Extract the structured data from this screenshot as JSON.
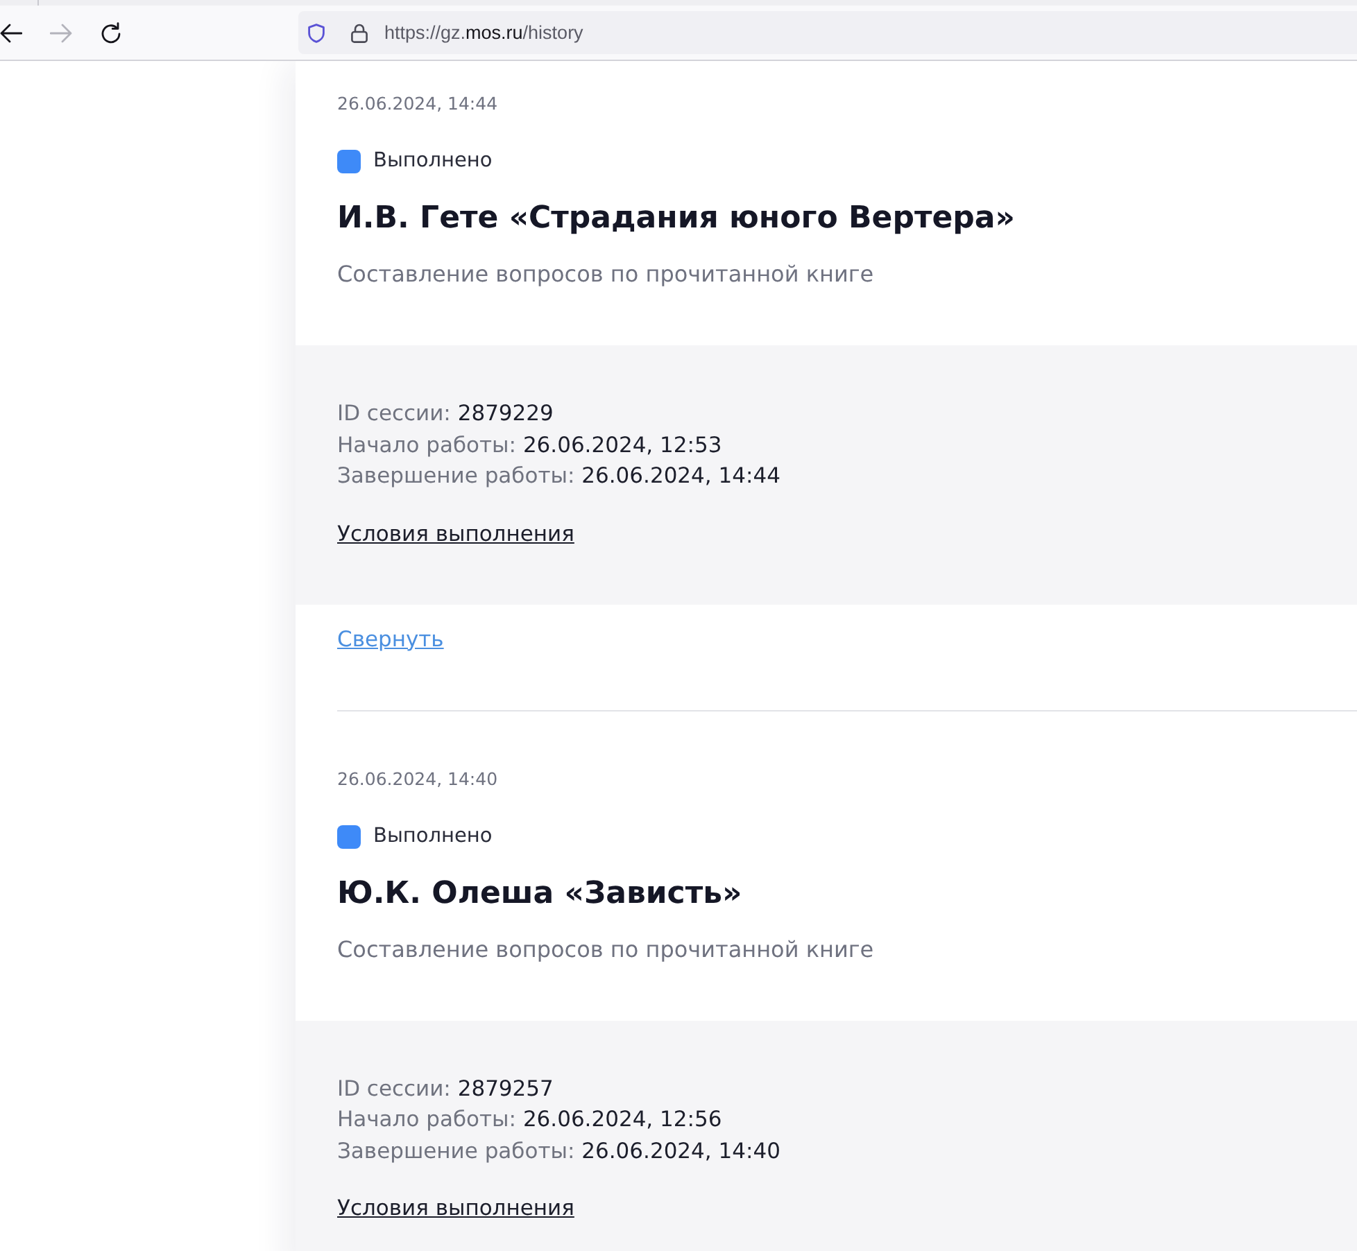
{
  "browser": {
    "nav_buttons": [
      {
        "kind": "back",
        "disabled": false
      },
      {
        "kind": "forward",
        "disabled": true
      },
      {
        "kind": "reload",
        "disabled": false
      }
    ],
    "url": [
      {
        "text": "https://gz.",
        "highlight": false
      },
      {
        "text": "mos.ru",
        "highlight": true
      },
      {
        "text": "/history",
        "highlight": false
      }
    ]
  },
  "history": [
    {
      "date": "26.06.2024, 14:44",
      "status": {
        "label": "Выполнено",
        "color": "#3e8af8"
      },
      "title": "И.В. Гете «Страдания юного Вертера»",
      "subtitle": "Составление вопросов по прочитанной книге",
      "expanded": true,
      "details": [
        {
          "label": "ID сессии:",
          "value": "2879229"
        },
        {
          "label": "Начало работы:",
          "value": "26.06.2024, 12:53"
        },
        {
          "label": "Завершение работы:",
          "value": "26.06.2024, 14:44"
        }
      ],
      "conditions_link": "Условия выполнения",
      "collapse_link": "Свернуть"
    },
    {
      "date": "26.06.2024, 14:40",
      "status": {
        "label": "Выполнено",
        "color": "#3e8af8"
      },
      "title": "Ю.К. Олеша «Зависть»",
      "subtitle": "Составление вопросов по прочитанной книге",
      "expanded": true,
      "details": [
        {
          "label": "ID сессии:",
          "value": "2879257"
        },
        {
          "label": "Начало работы:",
          "value": "26.06.2024, 12:56"
        },
        {
          "label": "Завершение работы:",
          "value": "26.06.2024, 14:40"
        }
      ],
      "conditions_link": "Условия выполнения"
    }
  ]
}
